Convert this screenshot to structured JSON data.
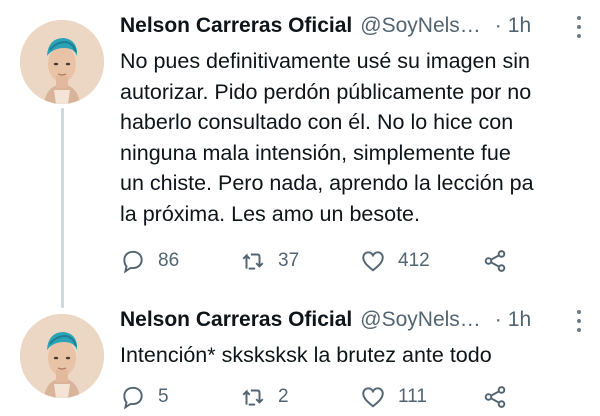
{
  "tweets": [
    {
      "author": {
        "display_name": "Nelson Carreras Oficial",
        "handle": "@SoyNels…"
      },
      "separator": "·",
      "time": "1h",
      "text": "No pues definitivamente usé su imagen sin\nautorizar. Pido perdón públicamente por no\nhaberlo consultado con él. No lo hice con\nninguna mala intensión, simplemente fue\nun chiste. Pero nada, aprendo la lección pa\nla próxima. Les amo un besote.",
      "replies": "86",
      "retweets": "37",
      "likes": "412"
    },
    {
      "author": {
        "display_name": "Nelson Carreras Oficial",
        "handle": "@SoyNels…"
      },
      "separator": "·",
      "time": "1h",
      "text": "Intención* sksksksk la brutez ante todo",
      "replies": "5",
      "retweets": "2",
      "likes": "111"
    }
  ],
  "icons": {
    "reply": "reply-icon",
    "retweet": "retweet-icon",
    "like": "heart-icon",
    "share": "share-icon",
    "more": "more-options-icon"
  },
  "colors": {
    "text": "#0f1419",
    "secondary": "#536471",
    "thread_line": "#cfd9de",
    "hair": "#2aa3b8"
  }
}
